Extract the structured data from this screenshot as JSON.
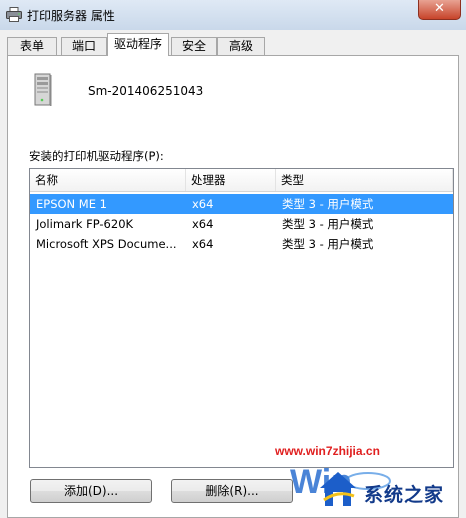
{
  "window": {
    "title": "打印服务器 属性",
    "close_glyph": "✕"
  },
  "tabs": [
    {
      "label": "表单"
    },
    {
      "label": "端口"
    },
    {
      "label": "驱动程序",
      "active": true
    },
    {
      "label": "安全"
    },
    {
      "label": "高级"
    }
  ],
  "server": {
    "name": "Sm-201406251043",
    "icon": "server-tower-icon"
  },
  "drivers": {
    "label": "安装的打印机驱动程序(P):",
    "columns": [
      "名称",
      "处理器",
      "类型"
    ],
    "rows": [
      {
        "name": "EPSON ME 1",
        "processor": "x64",
        "type": "类型 3 - 用户模式",
        "selected": true
      },
      {
        "name": "Jolimark FP-620K",
        "processor": "x64",
        "type": "类型 3 - 用户模式"
      },
      {
        "name": "Microsoft XPS Docume...",
        "processor": "x64",
        "type": "类型 3 - 用户模式"
      }
    ]
  },
  "buttons": {
    "add_label": "添加(D)...",
    "remove_label": "删除(R)..."
  },
  "watermark": {
    "url": "www.win7zhijia.cn",
    "brand": "系统之家"
  },
  "colors": {
    "selection": "#3399ff",
    "titlebar": "#dfe9f5",
    "close_button": "#c7442a",
    "watermark_url": "#e02020",
    "watermark_brand": "#123a8a"
  }
}
